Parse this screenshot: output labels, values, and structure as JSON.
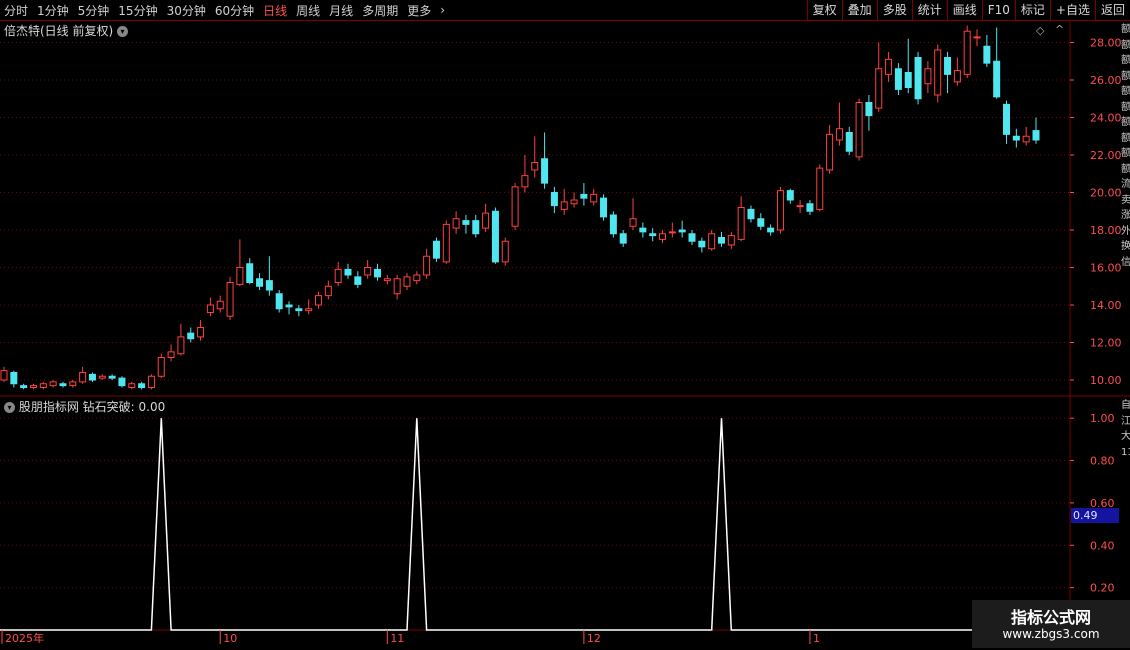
{
  "toolbar": {
    "periods": [
      "分时",
      "1分钟",
      "5分钟",
      "15分钟",
      "30分钟",
      "60分钟",
      "日线",
      "周线",
      "月线",
      "多周期",
      "更多"
    ],
    "active_period": "日线",
    "more_chevron": "›",
    "right_buttons": [
      "复权",
      "叠加",
      "多股",
      "统计",
      "画线",
      "F10",
      "标记",
      "+自选",
      "返回"
    ]
  },
  "price_panel": {
    "title": "倍杰特(日线 前复权)",
    "menu_icon": "chevron-down-circle-icon",
    "y_ticks": [
      "28.00",
      "26.00",
      "24.00",
      "22.00",
      "20.00",
      "18.00",
      "16.00",
      "14.00",
      "12.00",
      "10.00"
    ]
  },
  "indicator_panel": {
    "title": "股朋指标网 钻石突破: 0.00",
    "y_ticks": [
      "1.00",
      "0.80",
      "0.60",
      "0.40",
      "0.20"
    ],
    "cursor_value": "0.49"
  },
  "x_axis": {
    "labels": [
      "2025年",
      "10",
      "11",
      "12",
      "1"
    ]
  },
  "side_strip": {
    "upper": "额额额额额额额额额额流卖涨外换信",
    "lower": "自江大1111111111"
  },
  "watermark": {
    "line1": "指标公式网",
    "line2": "www.zbgs3.com"
  },
  "colors": {
    "up": "#ff4040",
    "down": "#50e6f0",
    "grid": "#7a0000",
    "axis_text": "#ff4d4d",
    "signal": "#ffffff"
  },
  "chart_data": {
    "type": "candlestick",
    "price_axis": {
      "ylim": [
        9.2,
        29.2
      ]
    },
    "candles": [
      {
        "o": 10.0,
        "c": 10.5,
        "h": 10.7,
        "l": 9.9
      },
      {
        "o": 10.4,
        "c": 9.8,
        "h": 10.5,
        "l": 9.6
      },
      {
        "o": 9.7,
        "c": 9.6,
        "h": 9.8,
        "l": 9.5
      },
      {
        "o": 9.6,
        "c": 9.7,
        "h": 9.8,
        "l": 9.5
      },
      {
        "o": 9.6,
        "c": 9.8,
        "h": 9.9,
        "l": 9.5
      },
      {
        "o": 9.7,
        "c": 9.9,
        "h": 10.0,
        "l": 9.6
      },
      {
        "o": 9.8,
        "c": 9.7,
        "h": 9.9,
        "l": 9.6
      },
      {
        "o": 9.7,
        "c": 9.9,
        "h": 10.0,
        "l": 9.6
      },
      {
        "o": 9.9,
        "c": 10.4,
        "h": 10.7,
        "l": 9.8
      },
      {
        "o": 10.3,
        "c": 10.0,
        "h": 10.4,
        "l": 9.9
      },
      {
        "o": 10.1,
        "c": 10.2,
        "h": 10.3,
        "l": 10.0
      },
      {
        "o": 10.2,
        "c": 10.1,
        "h": 10.3,
        "l": 10.0
      },
      {
        "o": 10.1,
        "c": 9.7,
        "h": 10.2,
        "l": 9.6
      },
      {
        "o": 9.6,
        "c": 9.8,
        "h": 9.9,
        "l": 9.5
      },
      {
        "o": 9.8,
        "c": 9.6,
        "h": 9.9,
        "l": 9.5
      },
      {
        "o": 9.6,
        "c": 10.2,
        "h": 10.3,
        "l": 9.5
      },
      {
        "o": 10.2,
        "c": 11.2,
        "h": 11.4,
        "l": 10.1
      },
      {
        "o": 11.2,
        "c": 11.5,
        "h": 11.9,
        "l": 11.0
      },
      {
        "o": 11.4,
        "c": 12.3,
        "h": 13.0,
        "l": 11.3
      },
      {
        "o": 12.5,
        "c": 12.2,
        "h": 12.8,
        "l": 12.0
      },
      {
        "o": 12.3,
        "c": 12.8,
        "h": 13.2,
        "l": 12.1
      },
      {
        "o": 13.6,
        "c": 14.0,
        "h": 14.4,
        "l": 13.4
      },
      {
        "o": 13.8,
        "c": 14.2,
        "h": 14.5,
        "l": 13.6
      },
      {
        "o": 13.4,
        "c": 15.2,
        "h": 15.5,
        "l": 13.2
      },
      {
        "o": 15.1,
        "c": 16.0,
        "h": 17.5,
        "l": 15.0
      },
      {
        "o": 16.2,
        "c": 15.2,
        "h": 16.5,
        "l": 15.1
      },
      {
        "o": 15.4,
        "c": 15.0,
        "h": 15.7,
        "l": 14.8
      },
      {
        "o": 15.3,
        "c": 14.8,
        "h": 16.6,
        "l": 14.5
      },
      {
        "o": 14.6,
        "c": 13.8,
        "h": 14.8,
        "l": 13.6
      },
      {
        "o": 14.0,
        "c": 13.9,
        "h": 14.2,
        "l": 13.5
      },
      {
        "o": 13.8,
        "c": 13.7,
        "h": 14.0,
        "l": 13.4
      },
      {
        "o": 13.7,
        "c": 13.8,
        "h": 14.3,
        "l": 13.5
      },
      {
        "o": 14.0,
        "c": 14.5,
        "h": 14.7,
        "l": 13.8
      },
      {
        "o": 14.5,
        "c": 15.0,
        "h": 15.3,
        "l": 14.3
      },
      {
        "o": 15.2,
        "c": 15.9,
        "h": 16.3,
        "l": 15.0
      },
      {
        "o": 15.9,
        "c": 15.6,
        "h": 16.2,
        "l": 15.4
      },
      {
        "o": 15.5,
        "c": 15.1,
        "h": 15.8,
        "l": 14.9
      },
      {
        "o": 15.6,
        "c": 16.0,
        "h": 16.4,
        "l": 15.4
      },
      {
        "o": 15.9,
        "c": 15.5,
        "h": 16.2,
        "l": 15.3
      },
      {
        "o": 15.3,
        "c": 15.4,
        "h": 15.6,
        "l": 15.1
      },
      {
        "o": 14.6,
        "c": 15.4,
        "h": 15.6,
        "l": 14.3
      },
      {
        "o": 15.0,
        "c": 15.5,
        "h": 15.7,
        "l": 14.8
      },
      {
        "o": 15.3,
        "c": 15.6,
        "h": 15.8,
        "l": 15.1
      },
      {
        "o": 15.6,
        "c": 16.6,
        "h": 17.0,
        "l": 15.4
      },
      {
        "o": 17.4,
        "c": 16.5,
        "h": 17.6,
        "l": 16.3
      },
      {
        "o": 16.3,
        "c": 18.3,
        "h": 18.5,
        "l": 16.2
      },
      {
        "o": 18.1,
        "c": 18.6,
        "h": 19.0,
        "l": 17.8
      },
      {
        "o": 18.5,
        "c": 18.3,
        "h": 18.8,
        "l": 17.8
      },
      {
        "o": 18.5,
        "c": 17.8,
        "h": 18.8,
        "l": 17.6
      },
      {
        "o": 18.1,
        "c": 18.9,
        "h": 19.4,
        "l": 17.9
      },
      {
        "o": 19.0,
        "c": 16.3,
        "h": 19.2,
        "l": 16.2
      },
      {
        "o": 16.3,
        "c": 17.4,
        "h": 17.6,
        "l": 16.1
      },
      {
        "o": 18.2,
        "c": 20.3,
        "h": 20.5,
        "l": 18.0
      },
      {
        "o": 20.3,
        "c": 20.9,
        "h": 22.0,
        "l": 20.0
      },
      {
        "o": 21.2,
        "c": 21.6,
        "h": 23.0,
        "l": 20.8
      },
      {
        "o": 21.8,
        "c": 20.5,
        "h": 23.2,
        "l": 20.2
      },
      {
        "o": 20.0,
        "c": 19.3,
        "h": 20.3,
        "l": 18.9
      },
      {
        "o": 19.1,
        "c": 19.5,
        "h": 20.2,
        "l": 18.8
      },
      {
        "o": 19.4,
        "c": 19.6,
        "h": 20.0,
        "l": 19.2
      },
      {
        "o": 19.9,
        "c": 19.7,
        "h": 20.5,
        "l": 19.3
      },
      {
        "o": 19.5,
        "c": 19.9,
        "h": 20.2,
        "l": 19.3
      },
      {
        "o": 19.7,
        "c": 18.7,
        "h": 19.9,
        "l": 18.5
      },
      {
        "o": 18.8,
        "c": 17.8,
        "h": 19.0,
        "l": 17.6
      },
      {
        "o": 17.8,
        "c": 17.3,
        "h": 18.0,
        "l": 17.1
      },
      {
        "o": 18.2,
        "c": 18.6,
        "h": 19.7,
        "l": 18.0
      },
      {
        "o": 18.1,
        "c": 17.9,
        "h": 18.4,
        "l": 17.6
      },
      {
        "o": 17.8,
        "c": 17.7,
        "h": 18.1,
        "l": 17.4
      },
      {
        "o": 17.5,
        "c": 17.8,
        "h": 18.0,
        "l": 17.3
      },
      {
        "o": 17.9,
        "c": 17.9,
        "h": 18.4,
        "l": 17.6
      },
      {
        "o": 18.0,
        "c": 17.9,
        "h": 18.5,
        "l": 17.6
      },
      {
        "o": 17.8,
        "c": 17.4,
        "h": 18.0,
        "l": 17.2
      },
      {
        "o": 17.4,
        "c": 17.1,
        "h": 17.6,
        "l": 16.8
      },
      {
        "o": 17.0,
        "c": 17.8,
        "h": 18.0,
        "l": 16.9
      },
      {
        "o": 17.6,
        "c": 17.3,
        "h": 17.9,
        "l": 17.1
      },
      {
        "o": 17.2,
        "c": 17.7,
        "h": 17.9,
        "l": 17.0
      },
      {
        "o": 17.5,
        "c": 19.2,
        "h": 19.8,
        "l": 17.4
      },
      {
        "o": 19.1,
        "c": 18.6,
        "h": 19.3,
        "l": 18.4
      },
      {
        "o": 18.6,
        "c": 18.2,
        "h": 18.9,
        "l": 18.0
      },
      {
        "o": 18.1,
        "c": 17.9,
        "h": 18.3,
        "l": 17.7
      },
      {
        "o": 18.0,
        "c": 20.1,
        "h": 20.3,
        "l": 17.8
      },
      {
        "o": 20.1,
        "c": 19.6,
        "h": 20.2,
        "l": 19.4
      },
      {
        "o": 19.3,
        "c": 19.3,
        "h": 19.6,
        "l": 18.9
      },
      {
        "o": 19.4,
        "c": 19.0,
        "h": 19.6,
        "l": 18.8
      },
      {
        "o": 19.1,
        "c": 21.3,
        "h": 21.5,
        "l": 19.0
      },
      {
        "o": 21.2,
        "c": 23.1,
        "h": 23.6,
        "l": 21.0
      },
      {
        "o": 22.8,
        "c": 23.4,
        "h": 24.8,
        "l": 22.5
      },
      {
        "o": 23.2,
        "c": 22.2,
        "h": 23.5,
        "l": 22.0
      },
      {
        "o": 21.9,
        "c": 24.8,
        "h": 25.0,
        "l": 21.7
      },
      {
        "o": 24.8,
        "c": 24.1,
        "h": 25.2,
        "l": 23.3
      },
      {
        "o": 24.5,
        "c": 26.6,
        "h": 28.0,
        "l": 24.3
      },
      {
        "o": 26.3,
        "c": 27.1,
        "h": 27.5,
        "l": 25.9
      },
      {
        "o": 26.6,
        "c": 25.5,
        "h": 26.9,
        "l": 25.2
      },
      {
        "o": 26.4,
        "c": 25.6,
        "h": 28.2,
        "l": 25.3
      },
      {
        "o": 27.2,
        "c": 25.0,
        "h": 27.5,
        "l": 24.7
      },
      {
        "o": 25.8,
        "c": 26.6,
        "h": 27.0,
        "l": 25.3
      },
      {
        "o": 25.2,
        "c": 27.6,
        "h": 27.9,
        "l": 24.8
      },
      {
        "o": 27.2,
        "c": 26.3,
        "h": 27.5,
        "l": 25.3
      },
      {
        "o": 25.9,
        "c": 26.5,
        "h": 27.2,
        "l": 25.7
      },
      {
        "o": 26.3,
        "c": 28.6,
        "h": 28.9,
        "l": 26.1
      },
      {
        "o": 28.3,
        "c": 28.3,
        "h": 28.7,
        "l": 27.8
      },
      {
        "o": 27.8,
        "c": 26.9,
        "h": 28.4,
        "l": 26.7
      },
      {
        "o": 27.0,
        "c": 25.1,
        "h": 28.8,
        "l": 25.0
      },
      {
        "o": 24.7,
        "c": 23.1,
        "h": 24.9,
        "l": 22.6
      },
      {
        "o": 23.0,
        "c": 22.8,
        "h": 23.4,
        "l": 22.4
      },
      {
        "o": 22.7,
        "c": 23.0,
        "h": 23.5,
        "l": 22.5
      },
      {
        "o": 23.3,
        "c": 22.8,
        "h": 24.0,
        "l": 22.6
      }
    ],
    "signal": {
      "name": "钻石突破",
      "ylim": [
        0,
        1.1
      ],
      "values": [
        0,
        0,
        0,
        0,
        0,
        0,
        0,
        0,
        0,
        0,
        0,
        0,
        0,
        0,
        0,
        0,
        1,
        0,
        0,
        0,
        0,
        0,
        0,
        0,
        0,
        0,
        0,
        0,
        0,
        0,
        0,
        0,
        0,
        0,
        0,
        0,
        0,
        0,
        0,
        0,
        0,
        0,
        1,
        0,
        0,
        0,
        0,
        0,
        0,
        0,
        0,
        0,
        0,
        0,
        0,
        0,
        0,
        0,
        0,
        0,
        0,
        0,
        0,
        0,
        0,
        0,
        0,
        0,
        0,
        0,
        0,
        0,
        0,
        1,
        0,
        0,
        0,
        0,
        0,
        0,
        0,
        0,
        0,
        0,
        0,
        0,
        0,
        0,
        0,
        0,
        0,
        0,
        0,
        0,
        0,
        0,
        0,
        0,
        0,
        0,
        0,
        0,
        0,
        0
      ]
    },
    "x_label_candle_index": [
      0,
      22,
      39,
      59,
      82
    ]
  }
}
